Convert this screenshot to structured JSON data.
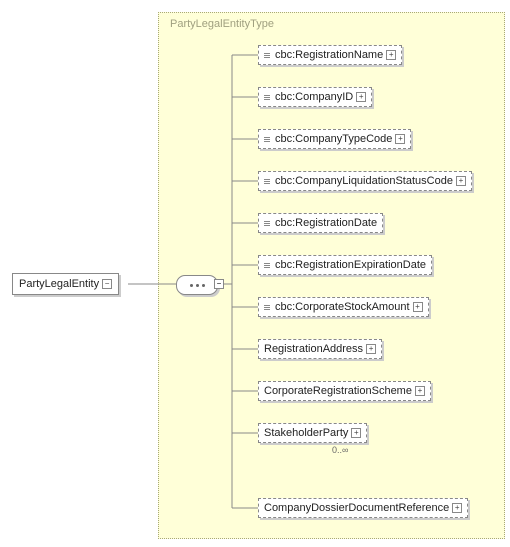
{
  "type_label": "PartyLegalEntityType",
  "root": {
    "label": "PartyLegalEntity"
  },
  "children": [
    {
      "label": "cbc:RegistrationName",
      "dashed": true,
      "expand": true,
      "bars": true
    },
    {
      "label": "cbc:CompanyID",
      "dashed": true,
      "expand": true,
      "bars": true
    },
    {
      "label": "cbc:CompanyTypeCode",
      "dashed": true,
      "expand": true,
      "bars": true
    },
    {
      "label": "cbc:CompanyLiquidationStatusCode",
      "dashed": true,
      "expand": true,
      "bars": true
    },
    {
      "label": "cbc:RegistrationDate",
      "dashed": true,
      "expand": false,
      "bars": true
    },
    {
      "label": "cbc:RegistrationExpirationDate",
      "dashed": true,
      "expand": false,
      "bars": true
    },
    {
      "label": "cbc:CorporateStockAmount",
      "dashed": true,
      "expand": true,
      "bars": true
    },
    {
      "label": "RegistrationAddress",
      "dashed": true,
      "expand": true,
      "bars": false
    },
    {
      "label": "CorporateRegistrationScheme",
      "dashed": true,
      "expand": true,
      "bars": false
    },
    {
      "label": "StakeholderParty",
      "dashed": true,
      "expand": true,
      "bars": false,
      "cardinality": "0..∞"
    },
    {
      "label": "CompanyDossierDocumentReference",
      "dashed": true,
      "expand": true,
      "bars": false
    }
  ]
}
